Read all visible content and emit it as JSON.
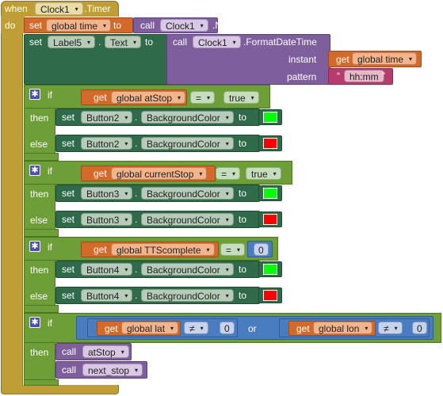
{
  "event": {
    "when": "when",
    "component": "Clock1",
    "event_name": ".Timer",
    "do": "do"
  },
  "set_time": {
    "set": "set",
    "var": "global time",
    "to": "to",
    "call": "call",
    "component": "Clock1",
    "method": ".Now"
  },
  "set_label": {
    "set": "set",
    "component": "Label5",
    "dot": ".",
    "prop": "Text",
    "to": "to",
    "call": "call",
    "fcomp": "Clock1",
    "method": ".FormatDateTime",
    "instant_label": "instant",
    "get": "get",
    "instant_var": "global time",
    "pattern_label": "pattern",
    "pattern_value": "hh:mm"
  },
  "if_blocks": [
    {
      "if": "if",
      "get": "get",
      "var": "global atStop",
      "op": "=",
      "value": "true",
      "then": "then",
      "else": "else",
      "then_set": {
        "set": "set",
        "comp": "Button2",
        "dot": ".",
        "prop": "BackgroundColor",
        "to": "to",
        "color": "#00ff00"
      },
      "else_set": {
        "set": "set",
        "comp": "Button2",
        "dot": ".",
        "prop": "BackgroundColor",
        "to": "to",
        "color": "#ff0000"
      }
    },
    {
      "if": "if",
      "get": "get",
      "var": "global currentStop",
      "op": "=",
      "value": "true",
      "then": "then",
      "else": "else",
      "then_set": {
        "set": "set",
        "comp": "Button3",
        "dot": ".",
        "prop": "BackgroundColor",
        "to": "to",
        "color": "#00ff00"
      },
      "else_set": {
        "set": "set",
        "comp": "Button3",
        "dot": ".",
        "prop": "BackgroundColor",
        "to": "to",
        "color": "#ff0000"
      }
    },
    {
      "if": "if",
      "get": "get",
      "var": "global TTScomplete",
      "op": "=",
      "value": "0",
      "then": "then",
      "else": "else",
      "then_set": {
        "set": "set",
        "comp": "Button4",
        "dot": ".",
        "prop": "BackgroundColor",
        "to": "to",
        "color": "#00ff00"
      },
      "else_set": {
        "set": "set",
        "comp": "Button4",
        "dot": ".",
        "prop": "BackgroundColor",
        "to": "to",
        "color": "#ff0000"
      }
    }
  ],
  "last_if": {
    "if": "if",
    "or": "or",
    "then": "then",
    "left": {
      "get": "get",
      "var": "global lat",
      "op": "≠",
      "value": "0"
    },
    "right": {
      "get": "get",
      "var": "global lon",
      "op": "≠",
      "value": "0"
    },
    "calls": [
      {
        "call": "call",
        "proc": "atStop"
      },
      {
        "call": "call",
        "proc": "next_stop"
      }
    ]
  },
  "arrow": "▾",
  "quote_open": "“",
  "quote_close": "”"
}
